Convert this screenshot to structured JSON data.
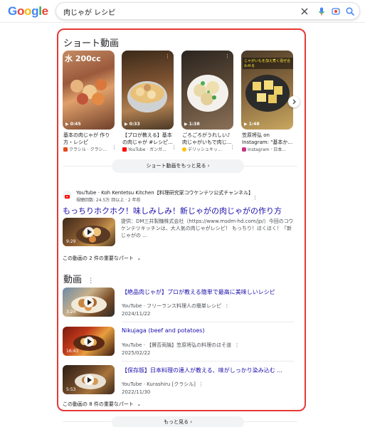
{
  "header": {
    "logo": [
      "G",
      "o",
      "o",
      "g",
      "l",
      "e"
    ],
    "search_value": "肉じゃが レシピ"
  },
  "shorts": {
    "title": "ショート動画",
    "items": [
      {
        "caption": "水 200cc",
        "duration": "0:45",
        "title": "基本の肉じゃが 作り方・レシピ",
        "source": "クラシル · クラシ..."
      },
      {
        "caption": "",
        "duration": "0:33",
        "title": "【プロが教える】基本の肉じゃが #レシピ...",
        "source": "YouTube · ガンガ..."
      },
      {
        "caption": "",
        "duration": "1:38",
        "title": "ごろごろがうれしい♪ 肉じゃがいもで肉じ...",
        "source": "デリッシュキッ..."
      },
      {
        "caption": "じゃがいもを加え煮く混ぜ合わせる",
        "duration": "1:48",
        "title": "笠原将弘 on Instagram: \"基本か...",
        "source": "Instagram · 日本..."
      }
    ],
    "more_button": "ショート動画をもっと見る"
  },
  "result": {
    "source_line": "YouTube · Koh Kentetsu Kitchen【料理研究家コウケンテツ公式チャンネル】",
    "meta_line": "視聴回数: 24.5万 回以上 · 2 年前",
    "title": "もっちりホクホク！味しみしみ！新じゃがの肉じゃがの作り方",
    "duration": "9:29",
    "snippet": "提供：DM三井製糖株式会社（https://www.msdm-hd.com/jp/）今回のコウケンテツキッチンは、大人気の肉じゃがレシピ！ もっちり！ほくほく！「新じゃがの ...",
    "parts_label": "この動画の 2 件の重要なパート"
  },
  "videos": {
    "title": "動画",
    "items": [
      {
        "title": "【絶品肉じゃが】プロが教える簡単で最高に美味しいレシピ",
        "source": "YouTube · フリーランス料理人の簡単レシピ",
        "date": "2024/11/22",
        "duration": "3:24"
      },
      {
        "title": "Nikujaga (beef and potatoes)",
        "source": "YouTube · 【賛否両論】笠原将弘の料理のほそ道",
        "date": "2025/02/22",
        "duration": "16:43"
      },
      {
        "title": "【保存版】日本料理の達人が教える、味がしっかり染み込む ...",
        "source": "YouTube · Kurashiru [クラシル]",
        "date": "2022/11/30",
        "duration": "5:53"
      }
    ],
    "parts_label": "この動画の 8 件の重要なパート"
  },
  "more_button": "もっと見る",
  "colors": {
    "highlight_border": "#e53935",
    "link": "#1a0dab"
  }
}
